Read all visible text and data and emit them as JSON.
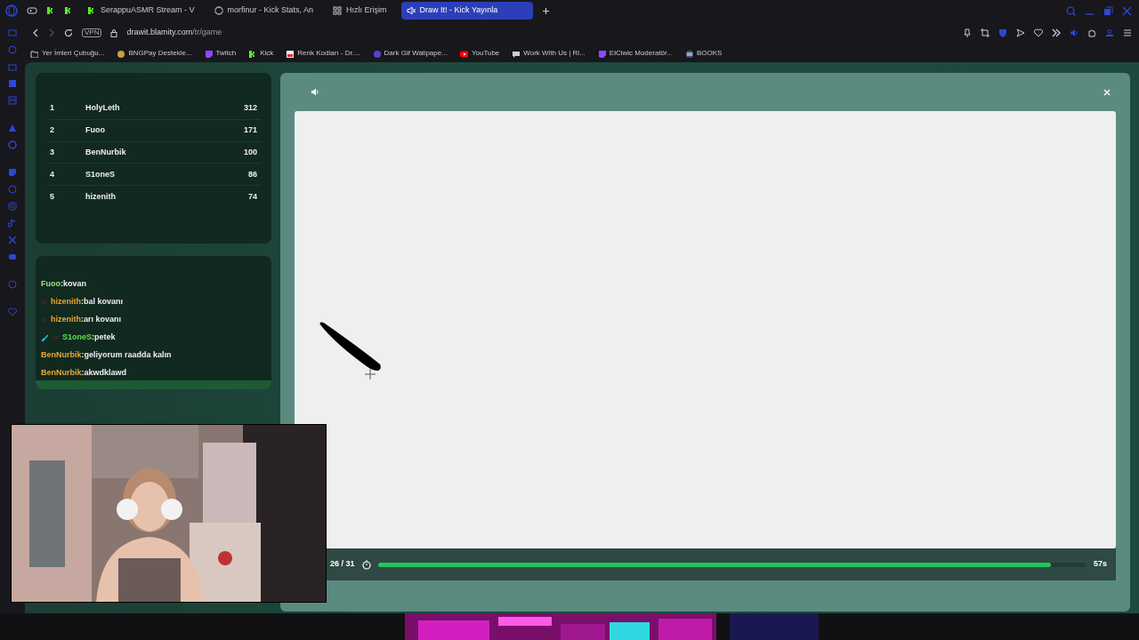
{
  "tabs": [
    {
      "label": "SerappuASMR Stream - V",
      "selected": false,
      "kind": "kick"
    },
    {
      "label": "morfinur - Kick Stats, An",
      "selected": false,
      "kind": "stats"
    },
    {
      "label": "Hızlı Erişim",
      "selected": false,
      "kind": "grid"
    },
    {
      "label": "Draw It! - Kick Yayınla",
      "selected": true,
      "kind": "draw"
    }
  ],
  "address_bar": {
    "vpn": "VPN",
    "url_host": "drawit.blamity.com",
    "url_path": "/tr/game"
  },
  "bookmarks": [
    {
      "label": "Yer İmleri Çubuğu...",
      "kind": "folder"
    },
    {
      "label": "BNGPay Destekle...",
      "kind": "coin"
    },
    {
      "label": "Twitch",
      "kind": "twitch"
    },
    {
      "label": "Kick",
      "kind": "kick"
    },
    {
      "label": "Renk Kodları - Dr....",
      "kind": "palette"
    },
    {
      "label": "Dark Gif Wallpape...",
      "kind": "circle"
    },
    {
      "label": "YouTube",
      "kind": "youtube"
    },
    {
      "label": "Work With Us | Ri...",
      "kind": "chat"
    },
    {
      "label": "ElCiwic Moderatör...",
      "kind": "twitch"
    },
    {
      "label": "BOOKS",
      "kind": "books"
    }
  ],
  "leaderboard": [
    {
      "rank": "1",
      "name": "HolyLeth",
      "score": "312"
    },
    {
      "rank": "2",
      "name": "Fuoo",
      "score": "171"
    },
    {
      "rank": "3",
      "name": "BenNurbik",
      "score": "100"
    },
    {
      "rank": "4",
      "name": "S1oneS",
      "score": "86"
    },
    {
      "rank": "5",
      "name": "hizenith",
      "score": "74"
    }
  ],
  "chat": [
    {
      "user": "Fuoo",
      "message": ":kovan",
      "color": "#9be27f",
      "kind": "plain"
    },
    {
      "user": "hizenith",
      "message": ":bal kovanı",
      "color": "#e8a43a",
      "kind": "badge"
    },
    {
      "user": "hizenith",
      "message": ":arı kovanı",
      "color": "#e8a43a",
      "kind": "badge"
    },
    {
      "user": "S1oneS",
      "message": ":petek",
      "color": "#55e24a",
      "kind": "sword"
    },
    {
      "user": "BenNurbik",
      "message": ":geliyorum raadda kalın",
      "color": "#e8a43a",
      "kind": "plain"
    },
    {
      "user": "BenNurbik",
      "message": ":akwdklawd",
      "color": "#e8a43a",
      "kind": "plain"
    }
  ],
  "game": {
    "round": "26 / 31",
    "timer": {
      "level": 0.95,
      "reading": "57s"
    }
  }
}
